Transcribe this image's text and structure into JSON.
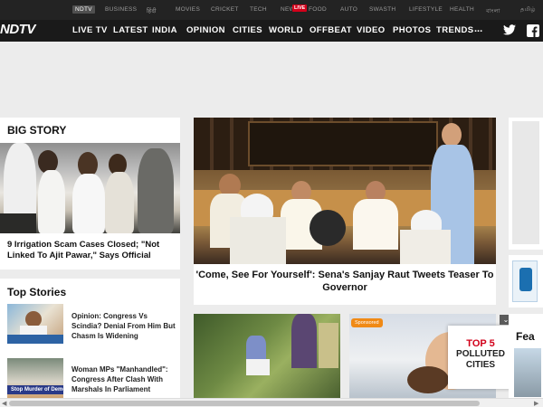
{
  "network": {
    "items": [
      {
        "label": "NDTV",
        "active": true
      },
      {
        "label": "BUSINESS"
      },
      {
        "label": "हिंदी"
      },
      {
        "label": "MOVIES"
      },
      {
        "label": "CRICKET"
      },
      {
        "label": "TECH"
      },
      {
        "label": "NEW"
      },
      {
        "label": "FOOD"
      },
      {
        "label": "AUTO"
      },
      {
        "label": "SWASTH"
      },
      {
        "label": "LIFESTYLE"
      },
      {
        "label": "HEALTH"
      },
      {
        "label": "বাংলা"
      },
      {
        "label": "தமிழ்"
      }
    ],
    "live_badge": "LIVE"
  },
  "nav": {
    "logo": "NDTV",
    "items": [
      "LIVE TV",
      "LATEST",
      "INDIA",
      "OPINION",
      "CITIES",
      "WORLD",
      "OFFBEAT",
      "VIDEO",
      "PHOTOS",
      "TRENDS"
    ],
    "more": "...",
    "social": [
      "twitter-icon",
      "facebook-icon"
    ]
  },
  "big_story": {
    "heading": "BIG STORY",
    "headline": "9 Irrigation Scam Cases Closed; \"Not Linked To Ajit Pawar,\" Says Official"
  },
  "hero": {
    "headline": "'Come, See For Yourself': Sena's Sanjay Raut Tweets Teaser To Governor"
  },
  "top_stories": {
    "heading": "Top Stories",
    "items": [
      {
        "title": "Opinion: Congress Vs Scindia? Denial From Him But Chasm Is Widening"
      },
      {
        "title": "Woman MPs \"Manhandled\": Congress After Clash With Marshals In Parliament"
      }
    ]
  },
  "promo": {
    "sponsored_label": "Sponsored",
    "pollution_line1": "TOP 5",
    "pollution_line2": "POLLUTED",
    "pollution_line3": "CITIES",
    "close": "⌄"
  },
  "right_partial": {
    "label": "Fea"
  },
  "colors": {
    "accent": "#d2001a",
    "nav_bg": "#1a1a1a",
    "strip_bg": "#232323",
    "sponsored": "#f08a16"
  }
}
